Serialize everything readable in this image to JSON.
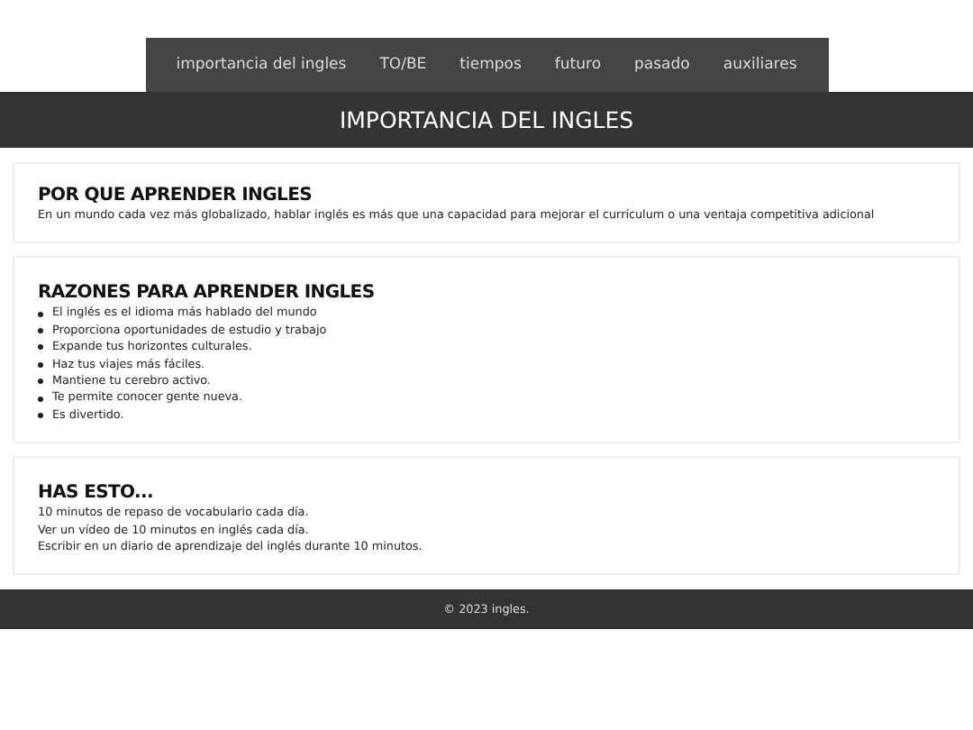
{
  "nav": {
    "items": [
      "importancia del ingles",
      "TO/BE",
      "tiempos",
      "futuro",
      "pasado",
      "auxiliares"
    ]
  },
  "header": {
    "title": "IMPORTANCIA DEL INGLES"
  },
  "sections": [
    {
      "kind": "paragraph",
      "title": "POR QUE APRENDER INGLES",
      "lines": [
        "En un mundo cada vez más globalizado, hablar inglés es más que una capacidad para mejorar el currículum o una ventaja competitiva adicional"
      ]
    },
    {
      "kind": "bullets",
      "title": "RAZONES PARA APRENDER INGLES",
      "lines": [
        "El inglés es el idioma más hablado del mundo",
        "Proporciona oportunidades de estudio y trabajo",
        "Expande tus horizontes culturales.",
        "Haz tus viajes más fáciles.",
        "Mantiene tu cerebro activo.",
        "Te permite conocer gente nueva.",
        "Es divertido."
      ]
    },
    {
      "kind": "paragraph",
      "title": "HAS ESTO...",
      "lines": [
        "10 minutos de repaso de vocabulario cada día.",
        "Ver un vídeo de 10 minutos en inglés cada día.",
        "Escribir en un diario de aprendizaje del inglés durante 10 minutos."
      ]
    }
  ],
  "footer": {
    "text": "© 2023 ingles."
  }
}
